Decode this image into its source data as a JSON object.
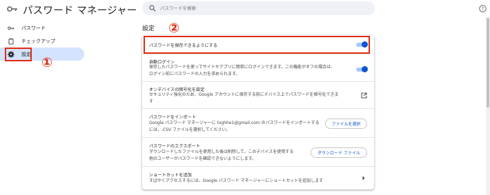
{
  "app": {
    "title": "パスワード マネージャー",
    "search_placeholder": "パスワードを検索"
  },
  "sidebar": {
    "items": [
      {
        "label": "パスワード",
        "icon": "key-icon"
      },
      {
        "label": "チェックアップ",
        "icon": "checkup-icon"
      },
      {
        "label": "設定",
        "icon": "gear-icon",
        "selected": true
      }
    ]
  },
  "main": {
    "section_title": "設定",
    "rows": [
      {
        "title": "パスワードを保存できるようにする",
        "toggle_on": true
      },
      {
        "title": "自動ログイン",
        "desc_1": "保存したパスワードを使ってサイトやアプリに簡単にログインできます。この機能がオフの場合は、",
        "desc_2": "ログイン前にパスワードの入力を求められます。",
        "toggle_on": true
      },
      {
        "title": "オンデバイスの暗号化を設定",
        "desc_1": "セキュリティ強化のため、Google アカウントに保存する前にデバイス上でパスワードを暗号化できま",
        "desc_2": "す"
      },
      {
        "title": "パスワードをインポート",
        "desc_1": "Google パスワード マネージャーに txghhe1@gmail.com のパスワードをインポートする",
        "desc_2": "には、.CSV ファイルを選択してください。",
        "button": "ファイルを選択"
      },
      {
        "title": "パスワードのエクスポート",
        "desc_1": "ダウンロードしたファイルを使用した後は削除して、このデバイスを使用する",
        "desc_2": "他のユーザーがパスワードを確認できないようにします。",
        "button": "ダウンロード ファイル"
      },
      {
        "title": "ショートカットを追加",
        "desc_1": "すばやくアクセスするには、Google パスワード マネージャーにショートカットを追加します"
      }
    ]
  },
  "annotations": {
    "marker_1": "①",
    "marker_2": "②",
    "highlight_color": "#e02a10"
  },
  "colors": {
    "accent": "#0b57d0",
    "selected_nav": "#d3e3fd",
    "toggle_track": "#a8c7fa"
  }
}
